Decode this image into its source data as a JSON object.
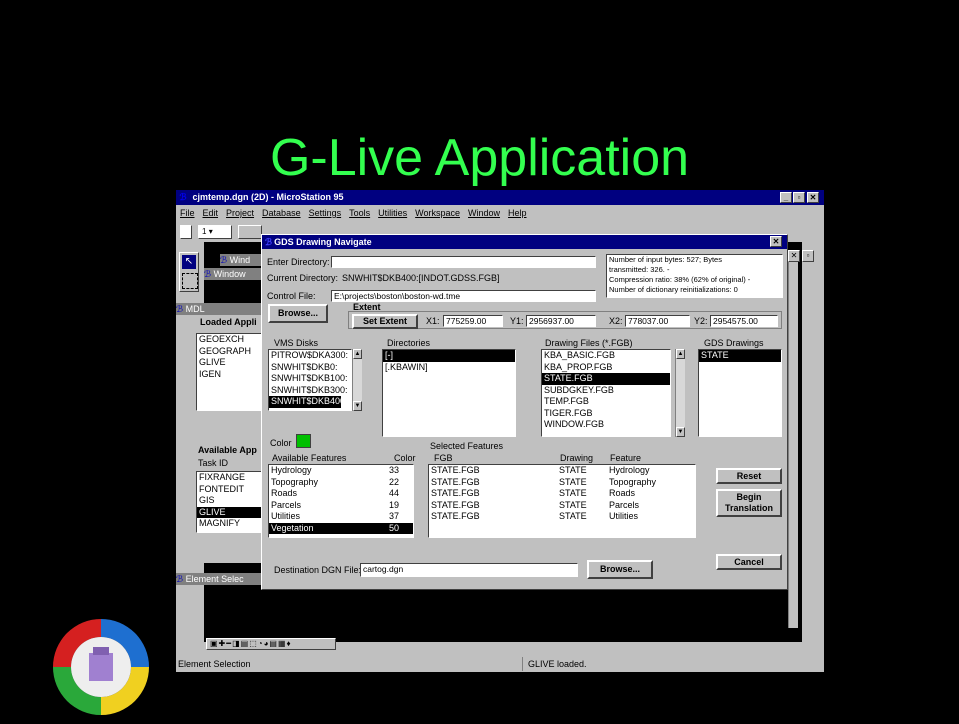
{
  "slide_title": "G-Live Application",
  "main_window": {
    "title": "cjmtemp.dgn (2D) - MicroStation 95",
    "menu": [
      "File",
      "Edit",
      "Project",
      "Database",
      "Settings",
      "Tools",
      "Utilities",
      "Workspace",
      "Window",
      "Help"
    ],
    "level_value": "1",
    "status_left": "Element Selection",
    "status_right": "GLIVE loaded."
  },
  "bg_windows": {
    "window1": "Wind",
    "window2": "Window",
    "mdl_title": "MDL",
    "loaded_apps_label": "Loaded Appli",
    "loaded_apps": [
      "GEOEXCH",
      "GEOGRAPH",
      "GLIVE",
      "IGEN"
    ],
    "available_apps_label": "Available App",
    "task_id_label": "Task ID",
    "available_apps": [
      "FIXRANGE",
      "FONTEDIT",
      "GIS",
      "GLIVE",
      "MAGNIFY"
    ],
    "available_selected": 3,
    "element_selection_title": "Element Selec"
  },
  "dialog": {
    "title": "GDS Drawing Navigate",
    "enter_directory_label": "Enter Directory:",
    "enter_directory_value": "",
    "current_directory_label": "Current Directory:",
    "current_directory_value": "SNWHIT$DKB400:[INDOT.GDSS.FGB]",
    "control_file_label": "Control File:",
    "control_file_value": "E:\\projects\\boston\\boston-wd.tme",
    "info_lines": [
      "Number of input bytes: 527; Bytes",
      "transmitted: 326. -",
      "Compression ratio: 38% (62% of original) -",
      "Number of dictionary reinitializations: 0"
    ],
    "browse_label": "Browse...",
    "extent_label": "Extent",
    "set_extent_label": "Set Extent",
    "x1_label": "X1:",
    "x1_value": "775259.00",
    "y1_label": "Y1:",
    "y1_value": "2956937.00",
    "x2_label": "X2:",
    "x2_value": "778037.00",
    "y2_label": "Y2:",
    "y2_value": "2954575.00",
    "vms_disks_label": "VMS Disks",
    "vms_disks": [
      "PITROW$DKA300:",
      "SNWHIT$DKB0:",
      "SNWHIT$DKB100:",
      "SNWHIT$DKB300:",
      "SNWHIT$DKB400:"
    ],
    "vms_selected": 4,
    "directories_label": "Directories",
    "directories": [
      "[-]",
      "[.KBAWIN]"
    ],
    "directories_selected": 0,
    "drawing_files_label": "Drawing Files (*.FGB)",
    "drawing_files": [
      "KBA_BASIC.FGB",
      "KBA_PROP.FGB",
      "STATE.FGB",
      "SUBDGKEY.FGB",
      "TEMP.FGB",
      "TIGER.FGB",
      "WINDOW.FGB"
    ],
    "drawing_files_selected": 2,
    "gds_drawings_label": "GDS Drawings",
    "gds_drawings": [
      "STATE"
    ],
    "gds_selected": 0,
    "color_label": "Color",
    "color_swatch": "#00c000",
    "available_features_label": "Available Features",
    "color_col_label": "Color",
    "available_features": [
      {
        "name": "Hydrology",
        "color": "33"
      },
      {
        "name": "Topography",
        "color": "22"
      },
      {
        "name": "Roads",
        "color": "44"
      },
      {
        "name": "Parcels",
        "color": "19"
      },
      {
        "name": "Utilities",
        "color": "37"
      },
      {
        "name": "Vegetation",
        "color": "50"
      }
    ],
    "available_selected": 5,
    "selected_features_label": "Selected Features",
    "fgb_col": "FGB",
    "drawing_col": "Drawing",
    "feature_col": "Feature",
    "selected_features": [
      {
        "fgb": "STATE.FGB",
        "drawing": "STATE",
        "feature": "Hydrology"
      },
      {
        "fgb": "STATE.FGB",
        "drawing": "STATE",
        "feature": "Topography"
      },
      {
        "fgb": "STATE.FGB",
        "drawing": "STATE",
        "feature": "Roads"
      },
      {
        "fgb": "STATE.FGB",
        "drawing": "STATE",
        "feature": "Parcels"
      },
      {
        "fgb": "STATE.FGB",
        "drawing": "STATE",
        "feature": "Utilities"
      }
    ],
    "reset_label": "Reset",
    "begin_line1": "Begin",
    "begin_line2": "Translation",
    "cancel_label": "Cancel",
    "destination_label": "Destination DGN File:",
    "destination_value": "cartog.dgn",
    "browse2_label": "Browse..."
  }
}
